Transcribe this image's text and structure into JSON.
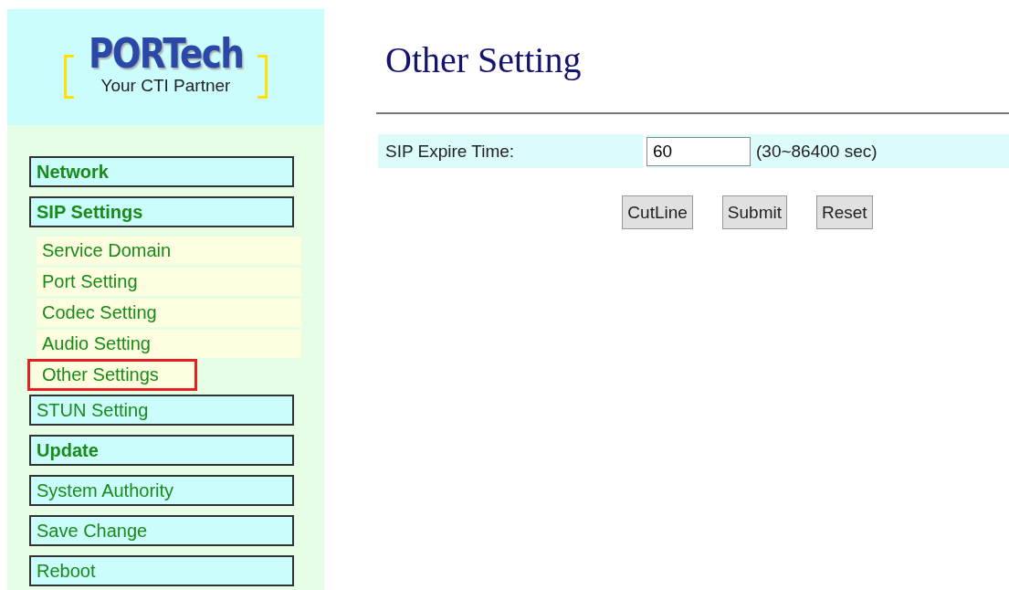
{
  "logo": {
    "name": "PORTech",
    "tagline": "Your CTI Partner"
  },
  "menu": [
    {
      "label": "Network",
      "kind": "group"
    },
    {
      "label": "SIP Settings",
      "kind": "group",
      "children": [
        {
          "label": "Service Domain",
          "highlighted": false
        },
        {
          "label": "Port Setting",
          "highlighted": false
        },
        {
          "label": "Codec Setting",
          "highlighted": false
        },
        {
          "label": "Audio Setting",
          "highlighted": false
        },
        {
          "label": "Other Settings",
          "highlighted": true
        }
      ]
    },
    {
      "label": "STUN Setting",
      "kind": "link"
    },
    {
      "label": "Update",
      "kind": "group"
    },
    {
      "label": "System Authority",
      "kind": "link"
    },
    {
      "label": "Save Change",
      "kind": "link"
    },
    {
      "label": "Reboot",
      "kind": "link"
    }
  ],
  "page_title": "Other Setting",
  "fields": [
    {
      "label": "SIP Expire Time:",
      "value": "60",
      "hint": "(30~86400 sec)"
    }
  ],
  "buttons": [
    "CutLine",
    "Submit",
    "Reset"
  ]
}
